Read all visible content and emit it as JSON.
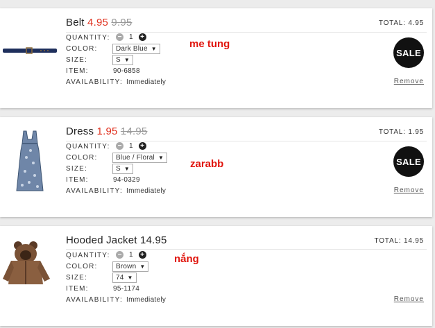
{
  "labels": {
    "quantity": "QUANTITY:",
    "color": "COLOR:",
    "size": "SIZE:",
    "item": "ITEM:",
    "availability": "AVAILABILITY:",
    "total": "TOTAL:",
    "remove": "Remove",
    "sale": "SALE",
    "minus": "−",
    "plus": "+"
  },
  "items": [
    {
      "name": "Belt",
      "price": "4.95",
      "old_price": "9.95",
      "quantity": "1",
      "color": "Dark Blue",
      "size": "S",
      "item_no": "90-6858",
      "availability": "Immediately",
      "total": "4.95",
      "note": "me tung",
      "on_sale": true
    },
    {
      "name": "Dress",
      "price": "1.95",
      "old_price": "14.95",
      "quantity": "1",
      "color": "Blue / Floral",
      "size": "S",
      "item_no": "94-0329",
      "availability": "Immediately",
      "total": "1.95",
      "note": "zarabb",
      "on_sale": true
    },
    {
      "name": "Hooded Jacket",
      "price": "14.95",
      "quantity": "1",
      "color": "Brown",
      "size": "74",
      "item_no": "95-1174",
      "availability": "Immediately",
      "total": "14.95",
      "note": "nắng",
      "on_sale": false
    }
  ]
}
